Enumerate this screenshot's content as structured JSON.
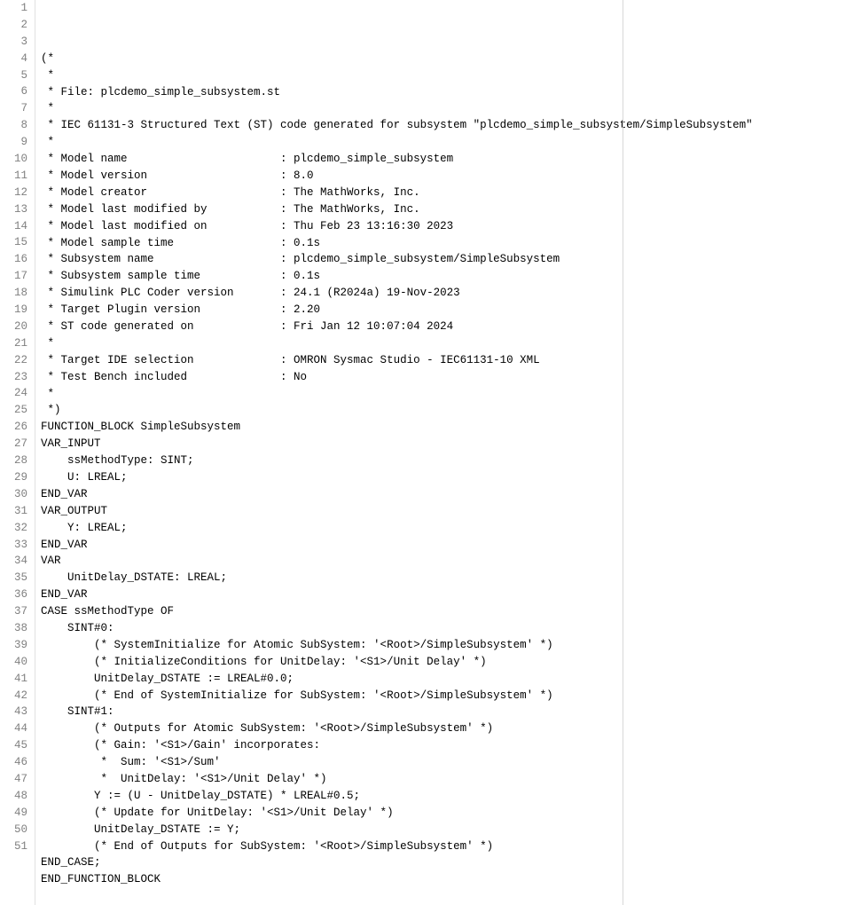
{
  "lines": [
    "(*",
    " *",
    " * File: plcdemo_simple_subsystem.st",
    " *",
    " * IEC 61131-3 Structured Text (ST) code generated for subsystem \"plcdemo_simple_subsystem/SimpleSubsystem\"",
    " *",
    " * Model name                       : plcdemo_simple_subsystem",
    " * Model version                    : 8.0",
    " * Model creator                    : The MathWorks, Inc.",
    " * Model last modified by           : The MathWorks, Inc.",
    " * Model last modified on           : Thu Feb 23 13:16:30 2023",
    " * Model sample time                : 0.1s",
    " * Subsystem name                   : plcdemo_simple_subsystem/SimpleSubsystem",
    " * Subsystem sample time            : 0.1s",
    " * Simulink PLC Coder version       : 24.1 (R2024a) 19-Nov-2023",
    " * Target Plugin version            : 2.20",
    " * ST code generated on             : Fri Jan 12 10:07:04 2024",
    " *",
    " * Target IDE selection             : OMRON Sysmac Studio - IEC61131-10 XML",
    " * Test Bench included              : No",
    " *",
    " *)",
    "FUNCTION_BLOCK SimpleSubsystem",
    "VAR_INPUT",
    "    ssMethodType: SINT;",
    "    U: LREAL;",
    "END_VAR",
    "VAR_OUTPUT",
    "    Y: LREAL;",
    "END_VAR",
    "VAR",
    "    UnitDelay_DSTATE: LREAL;",
    "END_VAR",
    "CASE ssMethodType OF",
    "    SINT#0:",
    "        (* SystemInitialize for Atomic SubSystem: '<Root>/SimpleSubsystem' *)",
    "        (* InitializeConditions for UnitDelay: '<S1>/Unit Delay' *)",
    "        UnitDelay_DSTATE := LREAL#0.0;",
    "        (* End of SystemInitialize for SubSystem: '<Root>/SimpleSubsystem' *)",
    "    SINT#1:",
    "        (* Outputs for Atomic SubSystem: '<Root>/SimpleSubsystem' *)",
    "        (* Gain: '<S1>/Gain' incorporates:",
    "         *  Sum: '<S1>/Sum'",
    "         *  UnitDelay: '<S1>/Unit Delay' *)",
    "        Y := (U - UnitDelay_DSTATE) * LREAL#0.5;",
    "        (* Update for UnitDelay: '<S1>/Unit Delay' *)",
    "        UnitDelay_DSTATE := Y;",
    "        (* End of Outputs for SubSystem: '<Root>/SimpleSubsystem' *)",
    "END_CASE;",
    "END_FUNCTION_BLOCK",
    ""
  ]
}
